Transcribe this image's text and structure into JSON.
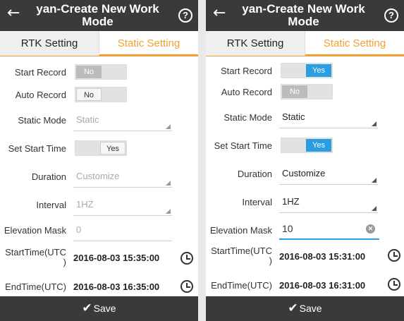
{
  "screens": [
    {
      "title": "yan-Create New Work Mode",
      "back_icon": "arrow-left-icon",
      "help_label": "?",
      "tabs": {
        "rtk": "RTK Setting",
        "static": "Static Setting"
      },
      "start_record": {
        "label": "Start Record",
        "no": "No",
        "yes": ""
      },
      "auto_record": {
        "label": "Auto Record",
        "no": "No",
        "yes": ""
      },
      "static_mode": {
        "label": "Static Mode",
        "value": "Static"
      },
      "set_start_time": {
        "label": "Set Start Time",
        "no": "",
        "yes": "Yes"
      },
      "duration": {
        "label": "Duration",
        "value": "Customize"
      },
      "interval": {
        "label": "Interval",
        "value": "1HZ"
      },
      "elevation_mask": {
        "label": "Elevation Mask",
        "value": "0"
      },
      "start_time": {
        "label_line1": "StartTime(UTC",
        "label_line2": ")",
        "value": "2016-08-03 15:35:00"
      },
      "end_time": {
        "label": "EndTime(UTC)",
        "value": "2016-08-03 16:35:00"
      },
      "save_label": "Save"
    },
    {
      "title": "yan-Create New Work Mode",
      "back_icon": "arrow-left-icon",
      "help_label": "?",
      "tabs": {
        "rtk": "RTK Setting",
        "static": "Static Setting"
      },
      "start_record": {
        "label": "Start Record",
        "no": "",
        "yes": "Yes"
      },
      "auto_record": {
        "label": "Auto Record",
        "no": "No",
        "yes": ""
      },
      "static_mode": {
        "label": "Static Mode",
        "value": "Static"
      },
      "set_start_time": {
        "label": "Set Start Time",
        "no": "",
        "yes": "Yes"
      },
      "duration": {
        "label": "Duration",
        "value": "Customize"
      },
      "interval": {
        "label": "Interval",
        "value": "1HZ"
      },
      "elevation_mask": {
        "label": "Elevation Mask",
        "value": "10"
      },
      "start_time": {
        "label_line1": "StartTime(UTC",
        "label_line2": ")",
        "value": "2016-08-03 15:31:00"
      },
      "end_time": {
        "label": "EndTime(UTC)",
        "value": "2016-08-03 16:31:00"
      },
      "save_label": "Save"
    }
  ],
  "colors": {
    "accent_orange": "#f0a030",
    "toggle_blue": "#2a9ee0",
    "bar_dark": "#3a3a3a"
  }
}
